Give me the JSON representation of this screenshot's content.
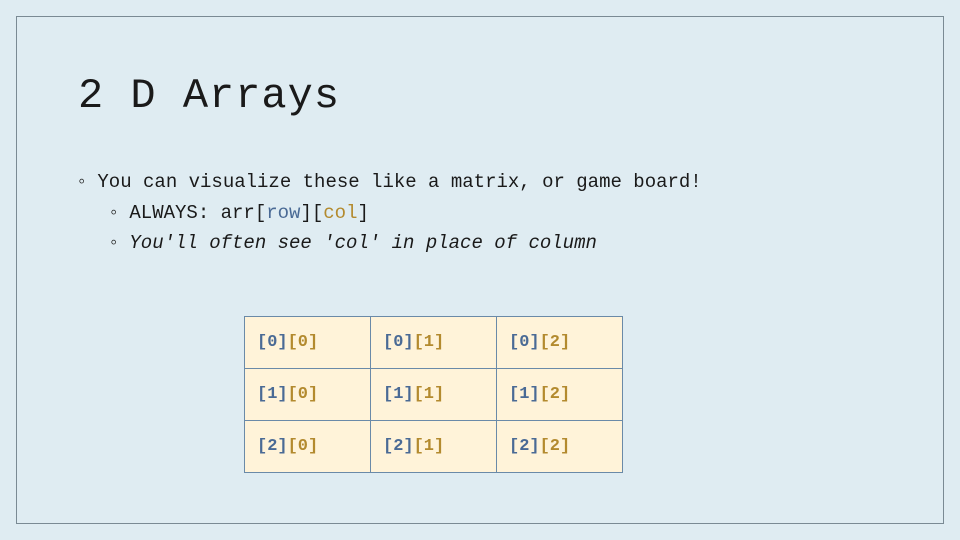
{
  "title": "2 D Arrays",
  "bullets": {
    "l1": "You can visualize these like a matrix, or game board!",
    "l2a_prefix": "ALWAYS: arr[",
    "l2a_row": "row",
    "l2a_mid": "][",
    "l2a_col": "col",
    "l2a_suffix": "]",
    "l2b": "You'll often see 'col' in place of column"
  },
  "table": {
    "rows": [
      [
        {
          "r": "[0]",
          "c": "[0]"
        },
        {
          "r": "[0]",
          "c": "[1]"
        },
        {
          "r": "[0]",
          "c": "[2]"
        }
      ],
      [
        {
          "r": "[1]",
          "c": "[0]"
        },
        {
          "r": "[1]",
          "c": "[1]"
        },
        {
          "r": "[1]",
          "c": "[2]"
        }
      ],
      [
        {
          "r": "[2]",
          "c": "[0]"
        },
        {
          "r": "[2]",
          "c": "[1]"
        },
        {
          "r": "[2]",
          "c": "[2]"
        }
      ]
    ]
  }
}
